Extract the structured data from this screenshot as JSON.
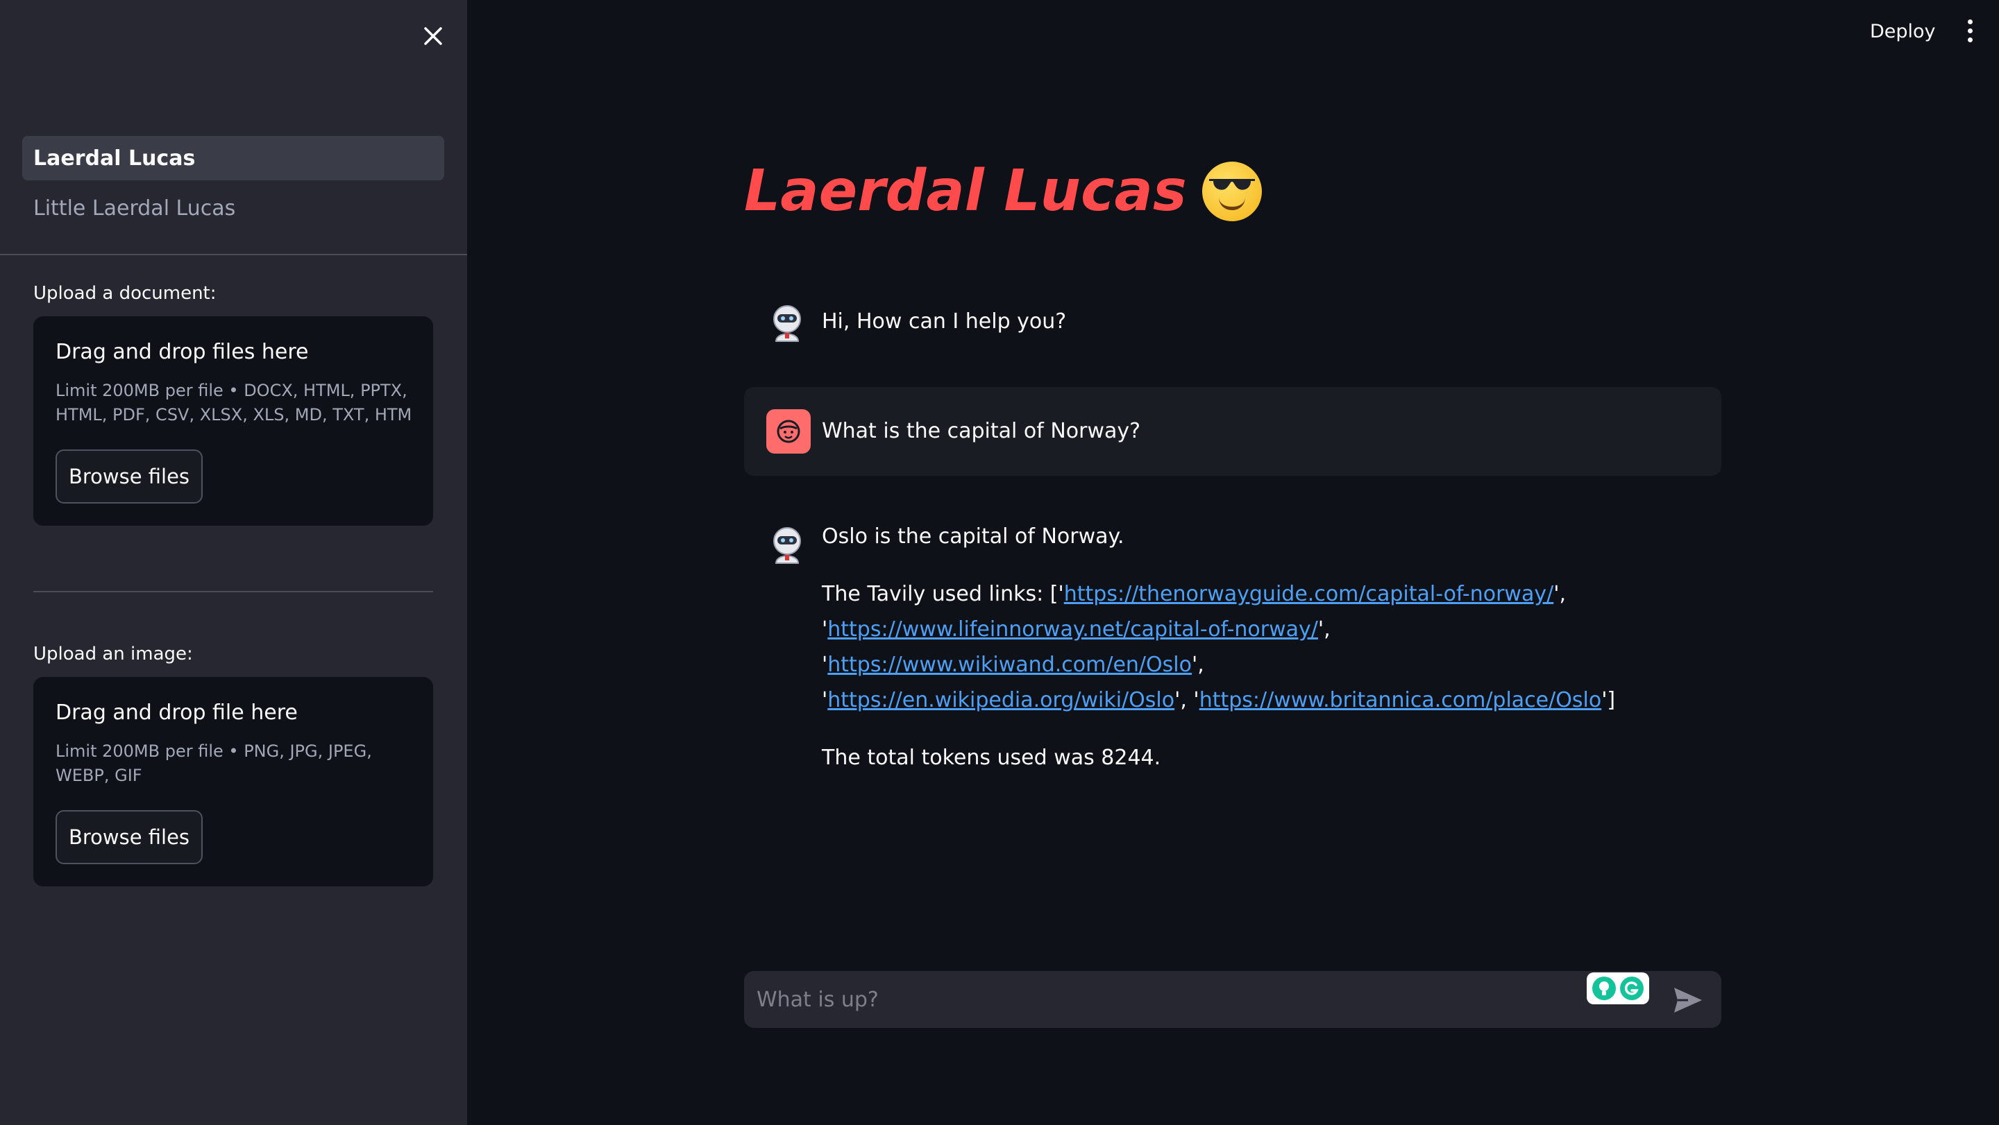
{
  "sidebar": {
    "nav_items": [
      {
        "label": "Laerdal Lucas",
        "active": true
      },
      {
        "label": "Little Laerdal Lucas",
        "active": false
      }
    ],
    "doc_upload": {
      "label": "Upload a document:",
      "title": "Drag and drop files here",
      "limit": "Limit 200MB per file • DOCX, HTML, PPTX, HTML, PDF, CSV, XLSX, XLS, MD, TXT, HTM",
      "button": "Browse files"
    },
    "image_upload": {
      "label": "Upload an image:",
      "title": "Drag and drop file here",
      "limit": "Limit 200MB per file • PNG, JPG, JPEG, WEBP, GIF",
      "button": "Browse files"
    }
  },
  "header": {
    "deploy_label": "Deploy"
  },
  "main": {
    "title": "Laerdal Lucas",
    "messages": {
      "greeting": "Hi, How can I help you?",
      "question": "What is the capital of Norway?",
      "answer": "Oslo is the capital of Norway.",
      "links_prefix": "The Tavily used links: ['",
      "links": [
        "https://thenorwayguide.com/capital-of-norway/",
        "https://www.lifeinnorway.net/capital-of-norway/",
        "https://www.wikiwand.com/en/Oslo",
        "https://en.wikipedia.org/wiki/Oslo",
        "https://www.britannica.com/place/Oslo"
      ],
      "links_sep_1": "',",
      "links_sep_2": "', '",
      "links_sep_3": "',",
      "links_sep_4": "', '",
      "links_suffix": "']",
      "quote": "'",
      "tokens": "The total tokens used was 8244."
    },
    "chat_input": {
      "placeholder": "What is up?"
    }
  },
  "colors": {
    "accent": "#ff4b4b",
    "link": "#4da0f5",
    "background": "#0e1117",
    "sidebar": "#262730"
  }
}
